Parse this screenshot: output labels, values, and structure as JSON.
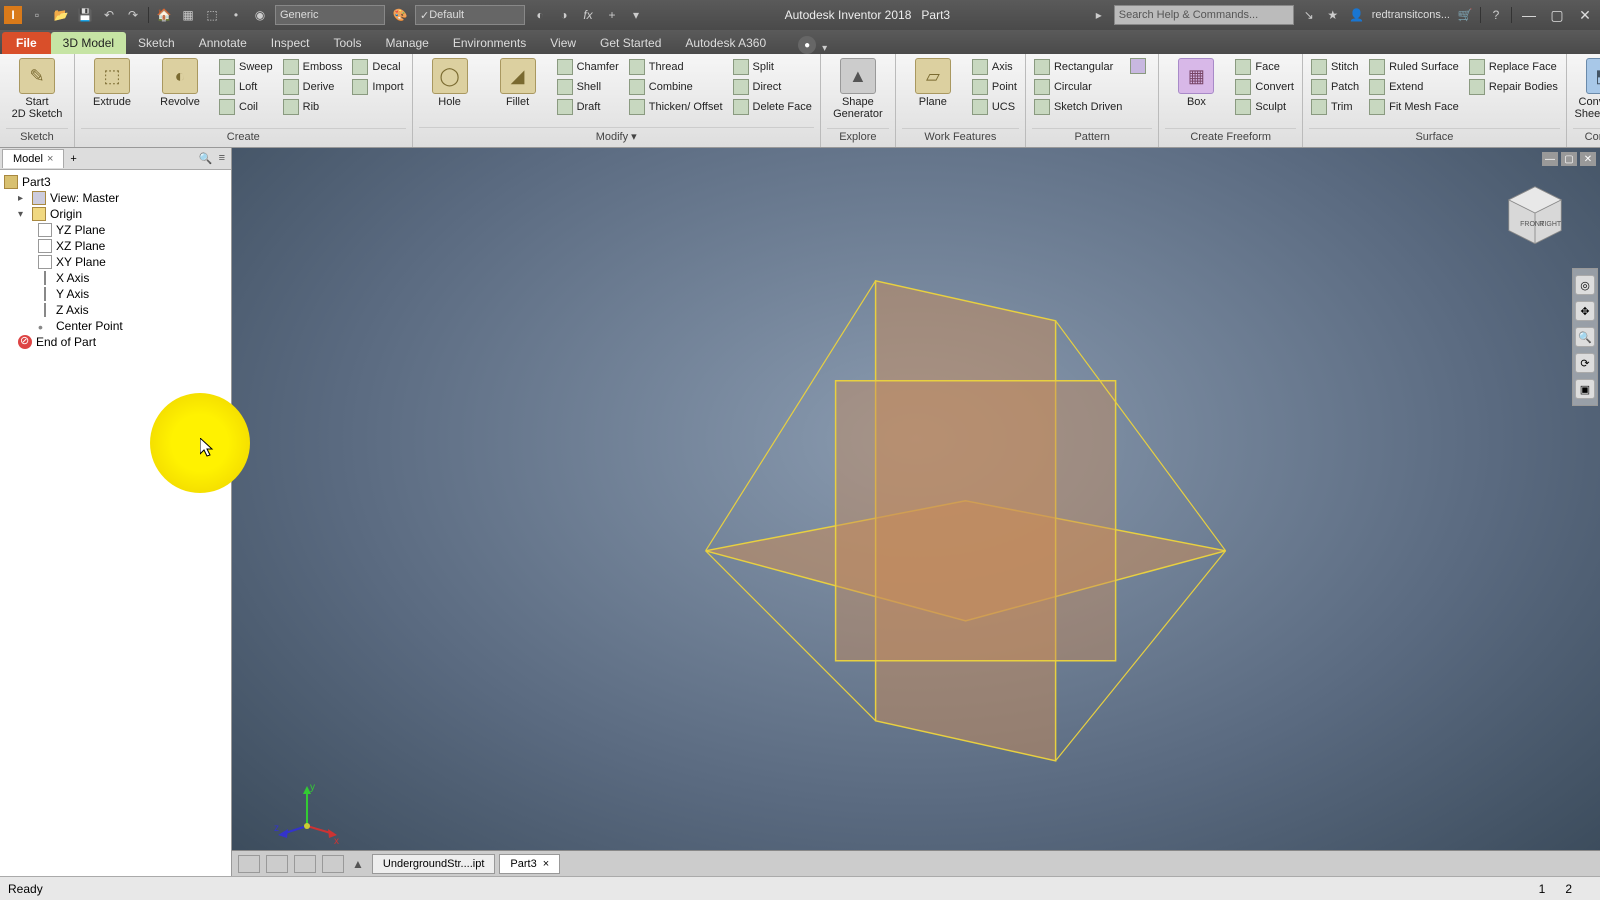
{
  "title_bar": {
    "app_title": "Autodesk Inventor 2018",
    "doc_title": "Part3",
    "search_placeholder": "Search Help & Commands...",
    "username": "redtransitcons...",
    "qat_material": "Generic",
    "qat_appearance": "Default"
  },
  "ribbon_tabs": {
    "file": "File",
    "items": [
      "3D Model",
      "Sketch",
      "Annotate",
      "Inspect",
      "Tools",
      "Manage",
      "Environments",
      "View",
      "Get Started",
      "Autodesk A360"
    ],
    "active": "3D Model"
  },
  "ribbon": {
    "sketch": {
      "label": "Sketch",
      "start": "Start\n2D Sketch"
    },
    "create": {
      "label": "Create",
      "extrude": "Extrude",
      "revolve": "Revolve",
      "col1": [
        "Sweep",
        "Loft",
        "Coil"
      ],
      "col2": [
        "Emboss",
        "Derive",
        "Rib"
      ],
      "col3": [
        "Decal",
        "Import"
      ]
    },
    "modify": {
      "label": "Modify ▾",
      "hole": "Hole",
      "fillet": "Fillet",
      "col1": [
        "Chamfer",
        "Shell",
        "Draft"
      ],
      "col2": [
        "Thread",
        "Combine",
        "Thicken/ Offset"
      ],
      "col3": [
        "Split",
        "Direct",
        "Delete Face"
      ]
    },
    "explore": {
      "label": "Explore",
      "shape": "Shape\nGenerator"
    },
    "work": {
      "label": "Work Features",
      "plane": "Plane",
      "col": [
        "Axis",
        "Point",
        "UCS"
      ]
    },
    "pattern": {
      "label": "Pattern",
      "col": [
        "Rectangular",
        "Circular",
        "Sketch Driven"
      ]
    },
    "freeform": {
      "label": "Create Freeform",
      "box": "Box",
      "col": [
        "Face",
        "Convert",
        "Sculpt"
      ]
    },
    "surface": {
      "label": "Surface",
      "col1": [
        "Stitch",
        "Patch",
        "Trim"
      ],
      "col2": [
        "Ruled Surface",
        "Extend",
        "Fit Mesh Face"
      ],
      "col3": [
        "Replace Face",
        "Repair Bodies"
      ]
    },
    "convert": {
      "label": "Convert",
      "btn": "Convert to\nSheet Metal"
    }
  },
  "browser": {
    "tab": "Model",
    "root": "Part3",
    "view": "View: Master",
    "origin": "Origin",
    "children": [
      "YZ Plane",
      "XZ Plane",
      "XY Plane",
      "X Axis",
      "Y Axis",
      "Z Axis",
      "Center Point"
    ],
    "end": "End of Part"
  },
  "doc_tabs": {
    "tabs": [
      "UndergroundStr....ipt",
      "Part3"
    ],
    "active": "Part3"
  },
  "status": {
    "ready": "Ready",
    "n1": "1",
    "n2": "2"
  },
  "triad": {
    "x": "x",
    "y": "y",
    "z": "z"
  },
  "viewcube": {
    "front": "FRONT",
    "right": "RIGHT"
  }
}
